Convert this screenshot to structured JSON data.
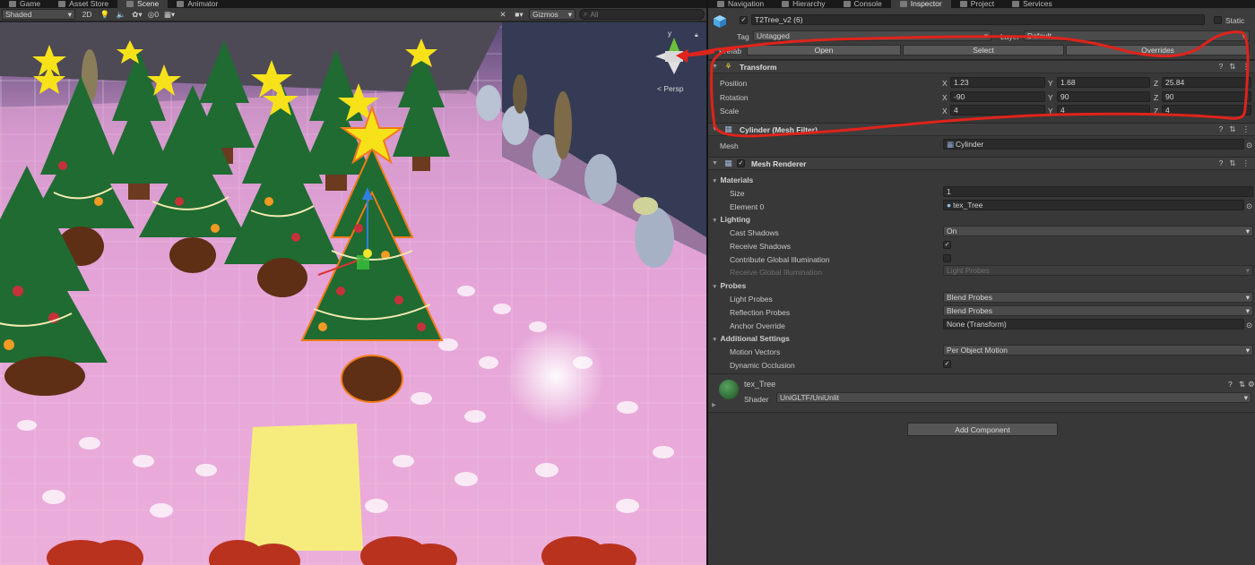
{
  "left_tabs": [
    {
      "label": "Game",
      "icon": "game-icon"
    },
    {
      "label": "Asset Store",
      "icon": "store-icon"
    },
    {
      "label": "Scene",
      "icon": "scene-icon"
    },
    {
      "label": "Animator",
      "icon": "animator-icon"
    }
  ],
  "right_tabs": [
    {
      "label": "Navigation",
      "icon": "navigation-icon"
    },
    {
      "label": "Hierarchy",
      "icon": "hierarchy-icon"
    },
    {
      "label": "Console",
      "icon": "console-icon"
    },
    {
      "label": "Inspector",
      "icon": "inspector-icon"
    },
    {
      "label": "Project",
      "icon": "project-icon"
    },
    {
      "label": "Services",
      "icon": "services-icon"
    }
  ],
  "scene_toolbar": {
    "shading_mode": "Shaded",
    "mode_2d": "2D",
    "fx_count": "0",
    "gizmos_label": "Gizmos",
    "search_placeholder": "All"
  },
  "scene": {
    "persp_label": "< Persp",
    "gizmo_y_label": "y"
  },
  "inspector": {
    "object_name": "T2Tree_v2 (6)",
    "static_label": "Static",
    "tag_label": "Tag",
    "tag_value": "Untagged",
    "layer_label": "Layer",
    "layer_value": "Default",
    "prefab_label": "Prefab",
    "open_label": "Open",
    "select_label": "Select",
    "overrides_label": "Overrides",
    "transform": {
      "title": "Transform",
      "rows": [
        {
          "label": "Position",
          "x": "1.23",
          "y": "1.68",
          "z": "25.84"
        },
        {
          "label": "Rotation",
          "x": "-90",
          "y": "90",
          "z": "90"
        },
        {
          "label": "Scale",
          "x": "4",
          "y": "4",
          "z": "4"
        }
      ]
    },
    "mesh_filter": {
      "title": "Cylinder (Mesh Filter)",
      "mesh_label": "Mesh",
      "mesh_value": "Cylinder"
    },
    "mesh_renderer": {
      "title": "Mesh Renderer",
      "materials_label": "Materials",
      "size_label": "Size",
      "size_value": "1",
      "element0_label": "Element 0",
      "element0_value": "tex_Tree",
      "lighting_label": "Lighting",
      "cast_shadows_label": "Cast Shadows",
      "cast_shadows_value": "On",
      "receive_shadows_label": "Receive Shadows",
      "contribute_gi_label": "Contribute Global Illumination",
      "receive_gi_label": "Receive Global Illumination",
      "receive_gi_value": "Light Probes",
      "probes_label": "Probes",
      "light_probes_label": "Light Probes",
      "light_probes_value": "Blend Probes",
      "reflection_probes_label": "Reflection Probes",
      "reflection_probes_value": "Blend Probes",
      "anchor_override_label": "Anchor Override",
      "anchor_override_value": "None (Transform)",
      "additional_settings_label": "Additional Settings",
      "motion_vectors_label": "Motion Vectors",
      "motion_vectors_value": "Per Object Motion",
      "dynamic_occlusion_label": "Dynamic Occlusion"
    },
    "material": {
      "name": "tex_Tree",
      "shader_label": "Shader",
      "shader_value": "UniGLTF/UniUnlit"
    },
    "add_component_label": "Add Component",
    "letters": {
      "x": "X",
      "y": "Y",
      "z": "Z"
    }
  },
  "colors": {
    "annotation": "#e0231b",
    "accent_blue": "#3a79bb",
    "tree_green": "#1f6b32",
    "star_yellow": "#f7e21a"
  }
}
